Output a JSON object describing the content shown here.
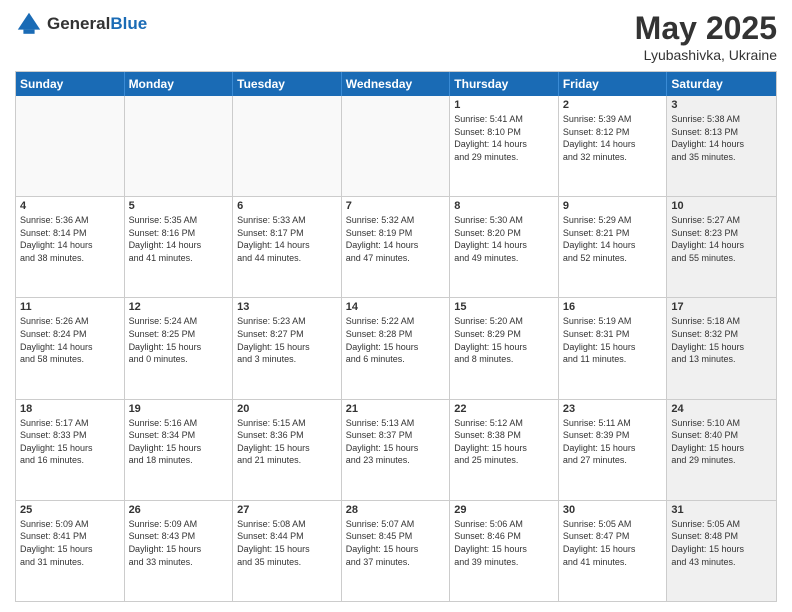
{
  "header": {
    "logo_general": "General",
    "logo_blue": "Blue",
    "month": "May 2025",
    "location": "Lyubashivka, Ukraine"
  },
  "days_of_week": [
    "Sunday",
    "Monday",
    "Tuesday",
    "Wednesday",
    "Thursday",
    "Friday",
    "Saturday"
  ],
  "weeks": [
    [
      {
        "day": "",
        "text": "",
        "empty": true
      },
      {
        "day": "",
        "text": "",
        "empty": true
      },
      {
        "day": "",
        "text": "",
        "empty": true
      },
      {
        "day": "",
        "text": "",
        "empty": true
      },
      {
        "day": "1",
        "text": "Sunrise: 5:41 AM\nSunset: 8:10 PM\nDaylight: 14 hours\nand 29 minutes.",
        "shaded": false
      },
      {
        "day": "2",
        "text": "Sunrise: 5:39 AM\nSunset: 8:12 PM\nDaylight: 14 hours\nand 32 minutes.",
        "shaded": false
      },
      {
        "day": "3",
        "text": "Sunrise: 5:38 AM\nSunset: 8:13 PM\nDaylight: 14 hours\nand 35 minutes.",
        "shaded": true
      }
    ],
    [
      {
        "day": "4",
        "text": "Sunrise: 5:36 AM\nSunset: 8:14 PM\nDaylight: 14 hours\nand 38 minutes.",
        "shaded": false
      },
      {
        "day": "5",
        "text": "Sunrise: 5:35 AM\nSunset: 8:16 PM\nDaylight: 14 hours\nand 41 minutes.",
        "shaded": false
      },
      {
        "day": "6",
        "text": "Sunrise: 5:33 AM\nSunset: 8:17 PM\nDaylight: 14 hours\nand 44 minutes.",
        "shaded": false
      },
      {
        "day": "7",
        "text": "Sunrise: 5:32 AM\nSunset: 8:19 PM\nDaylight: 14 hours\nand 47 minutes.",
        "shaded": false
      },
      {
        "day": "8",
        "text": "Sunrise: 5:30 AM\nSunset: 8:20 PM\nDaylight: 14 hours\nand 49 minutes.",
        "shaded": false
      },
      {
        "day": "9",
        "text": "Sunrise: 5:29 AM\nSunset: 8:21 PM\nDaylight: 14 hours\nand 52 minutes.",
        "shaded": false
      },
      {
        "day": "10",
        "text": "Sunrise: 5:27 AM\nSunset: 8:23 PM\nDaylight: 14 hours\nand 55 minutes.",
        "shaded": true
      }
    ],
    [
      {
        "day": "11",
        "text": "Sunrise: 5:26 AM\nSunset: 8:24 PM\nDaylight: 14 hours\nand 58 minutes.",
        "shaded": false
      },
      {
        "day": "12",
        "text": "Sunrise: 5:24 AM\nSunset: 8:25 PM\nDaylight: 15 hours\nand 0 minutes.",
        "shaded": false
      },
      {
        "day": "13",
        "text": "Sunrise: 5:23 AM\nSunset: 8:27 PM\nDaylight: 15 hours\nand 3 minutes.",
        "shaded": false
      },
      {
        "day": "14",
        "text": "Sunrise: 5:22 AM\nSunset: 8:28 PM\nDaylight: 15 hours\nand 6 minutes.",
        "shaded": false
      },
      {
        "day": "15",
        "text": "Sunrise: 5:20 AM\nSunset: 8:29 PM\nDaylight: 15 hours\nand 8 minutes.",
        "shaded": false
      },
      {
        "day": "16",
        "text": "Sunrise: 5:19 AM\nSunset: 8:31 PM\nDaylight: 15 hours\nand 11 minutes.",
        "shaded": false
      },
      {
        "day": "17",
        "text": "Sunrise: 5:18 AM\nSunset: 8:32 PM\nDaylight: 15 hours\nand 13 minutes.",
        "shaded": true
      }
    ],
    [
      {
        "day": "18",
        "text": "Sunrise: 5:17 AM\nSunset: 8:33 PM\nDaylight: 15 hours\nand 16 minutes.",
        "shaded": false
      },
      {
        "day": "19",
        "text": "Sunrise: 5:16 AM\nSunset: 8:34 PM\nDaylight: 15 hours\nand 18 minutes.",
        "shaded": false
      },
      {
        "day": "20",
        "text": "Sunrise: 5:15 AM\nSunset: 8:36 PM\nDaylight: 15 hours\nand 21 minutes.",
        "shaded": false
      },
      {
        "day": "21",
        "text": "Sunrise: 5:13 AM\nSunset: 8:37 PM\nDaylight: 15 hours\nand 23 minutes.",
        "shaded": false
      },
      {
        "day": "22",
        "text": "Sunrise: 5:12 AM\nSunset: 8:38 PM\nDaylight: 15 hours\nand 25 minutes.",
        "shaded": false
      },
      {
        "day": "23",
        "text": "Sunrise: 5:11 AM\nSunset: 8:39 PM\nDaylight: 15 hours\nand 27 minutes.",
        "shaded": false
      },
      {
        "day": "24",
        "text": "Sunrise: 5:10 AM\nSunset: 8:40 PM\nDaylight: 15 hours\nand 29 minutes.",
        "shaded": true
      }
    ],
    [
      {
        "day": "25",
        "text": "Sunrise: 5:09 AM\nSunset: 8:41 PM\nDaylight: 15 hours\nand 31 minutes.",
        "shaded": false
      },
      {
        "day": "26",
        "text": "Sunrise: 5:09 AM\nSunset: 8:43 PM\nDaylight: 15 hours\nand 33 minutes.",
        "shaded": false
      },
      {
        "day": "27",
        "text": "Sunrise: 5:08 AM\nSunset: 8:44 PM\nDaylight: 15 hours\nand 35 minutes.",
        "shaded": false
      },
      {
        "day": "28",
        "text": "Sunrise: 5:07 AM\nSunset: 8:45 PM\nDaylight: 15 hours\nand 37 minutes.",
        "shaded": false
      },
      {
        "day": "29",
        "text": "Sunrise: 5:06 AM\nSunset: 8:46 PM\nDaylight: 15 hours\nand 39 minutes.",
        "shaded": false
      },
      {
        "day": "30",
        "text": "Sunrise: 5:05 AM\nSunset: 8:47 PM\nDaylight: 15 hours\nand 41 minutes.",
        "shaded": false
      },
      {
        "day": "31",
        "text": "Sunrise: 5:05 AM\nSunset: 8:48 PM\nDaylight: 15 hours\nand 43 minutes.",
        "shaded": true
      }
    ]
  ]
}
